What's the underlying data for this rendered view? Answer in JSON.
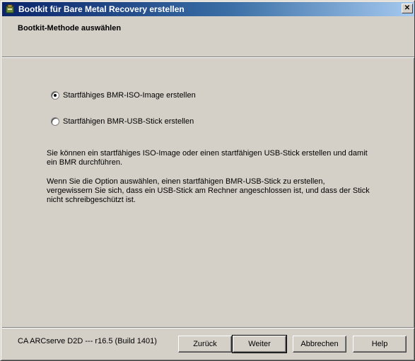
{
  "window": {
    "title": "Bootkit für Bare Metal Recovery erstellen",
    "close_label": "✕"
  },
  "header": {
    "title": "Bootkit-Methode auswählen"
  },
  "options": [
    {
      "label": "Startfähiges BMR-ISO-Image erstellen",
      "selected": true
    },
    {
      "label": "Startfähigen BMR-USB-Stick erstellen",
      "selected": false
    }
  ],
  "description": {
    "para1": "Sie können ein startfähiges ISO-Image oder einen startfähigen USB-Stick erstellen und damit ein BMR durchführen.",
    "para2": "Wenn Sie die Option auswählen, einen startfähigen BMR-USB-Stick zu erstellen, vergewissern Sie sich, dass ein USB-Stick am Rechner angeschlossen ist, und dass der Stick nicht schreibgeschützt ist."
  },
  "footer": {
    "version": "CA ARCserve D2D --- r16.5 (Build 1401)",
    "back_label": "Zurück",
    "next_label": "Weiter",
    "cancel_label": "Abbrechen",
    "help_label": "Help"
  },
  "colors": {
    "titlebar_start": "#0a246a",
    "titlebar_end": "#a6caf0",
    "face": "#d4d0c8"
  }
}
